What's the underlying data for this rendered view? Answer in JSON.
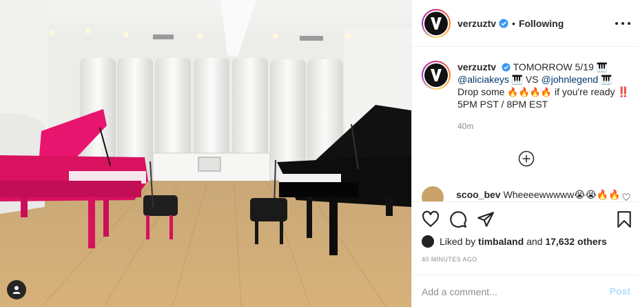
{
  "post": {
    "username": "verzuztv",
    "verified": true,
    "follow_separator": "•",
    "follow_status": "Following",
    "avatar_letter": "V"
  },
  "caption": {
    "username": "verzuztv",
    "line1_text": "TOMORROW 5/19",
    "mention1": "@aliciakeys",
    "piano_emoji": "🎹",
    "vs": "VS",
    "mention2": "@johnlegend",
    "line3_prefix": "Drop some",
    "fire_emojis": "🔥🔥🔥🔥",
    "line3_suffix": "if you're ready ‼️",
    "line4": "5PM PST / 8PM EST",
    "time": "40m"
  },
  "comment": {
    "username": "scoo_bev",
    "text": "Wheeeewwwww😭😭🔥🔥"
  },
  "likes": {
    "prefix": "Liked by",
    "user": "timbaland",
    "connector": "and",
    "count": "17,632 others"
  },
  "timestamp": "40 MINUTES AGO",
  "comment_input": {
    "placeholder": "Add a comment...",
    "post_label": "Post"
  },
  "icons": {
    "more": "more-options-icon",
    "load_more": "load-more-comments-icon",
    "like": "heart-icon",
    "comment": "comment-icon",
    "share": "share-icon",
    "save": "bookmark-icon",
    "tag": "user-tag-icon"
  },
  "colors": {
    "text": "#262626",
    "mention": "#00376b",
    "muted": "#8e8e8e",
    "post_disabled": "#b2dffc",
    "verified": "#3897f0"
  }
}
